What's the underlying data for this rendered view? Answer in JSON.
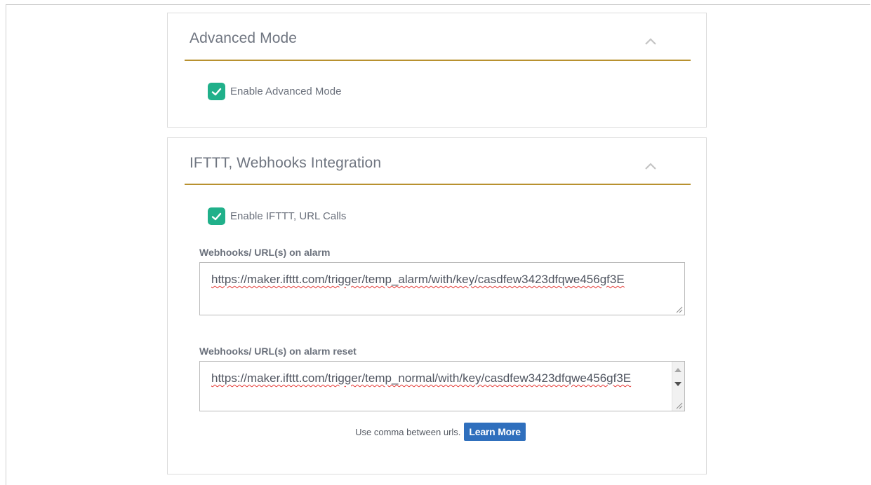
{
  "advanced": {
    "title": "Advanced Mode",
    "checkbox_label": "Enable Advanced Mode",
    "checked": true
  },
  "ifttt": {
    "title": "IFTTT, Webhooks Integration",
    "checkbox_label": "Enable IFTTT, URL Calls",
    "checked": true,
    "alarm": {
      "label": "Webhooks/ URL(s) on alarm",
      "value": "https://maker.ifttt.com/trigger/temp_alarm/with/key/casdfew3423dfqwe456gf3E"
    },
    "reset": {
      "label": "Webhooks/ URL(s) on alarm reset",
      "value": "https://maker.ifttt.com/trigger/temp_normal/with/key/casdfew3423dfqwe456gf3E"
    },
    "hint": "Use comma between urls.",
    "learn_more": "Learn More"
  },
  "colors": {
    "accent_rule": "#b8912f",
    "checkbox": "#20b08a",
    "button": "#2f6fbd"
  },
  "icons": [
    "chevron-up-icon",
    "checkmark-icon",
    "resize-grip-icon",
    "scroll-up-icon",
    "scroll-down-icon"
  ]
}
